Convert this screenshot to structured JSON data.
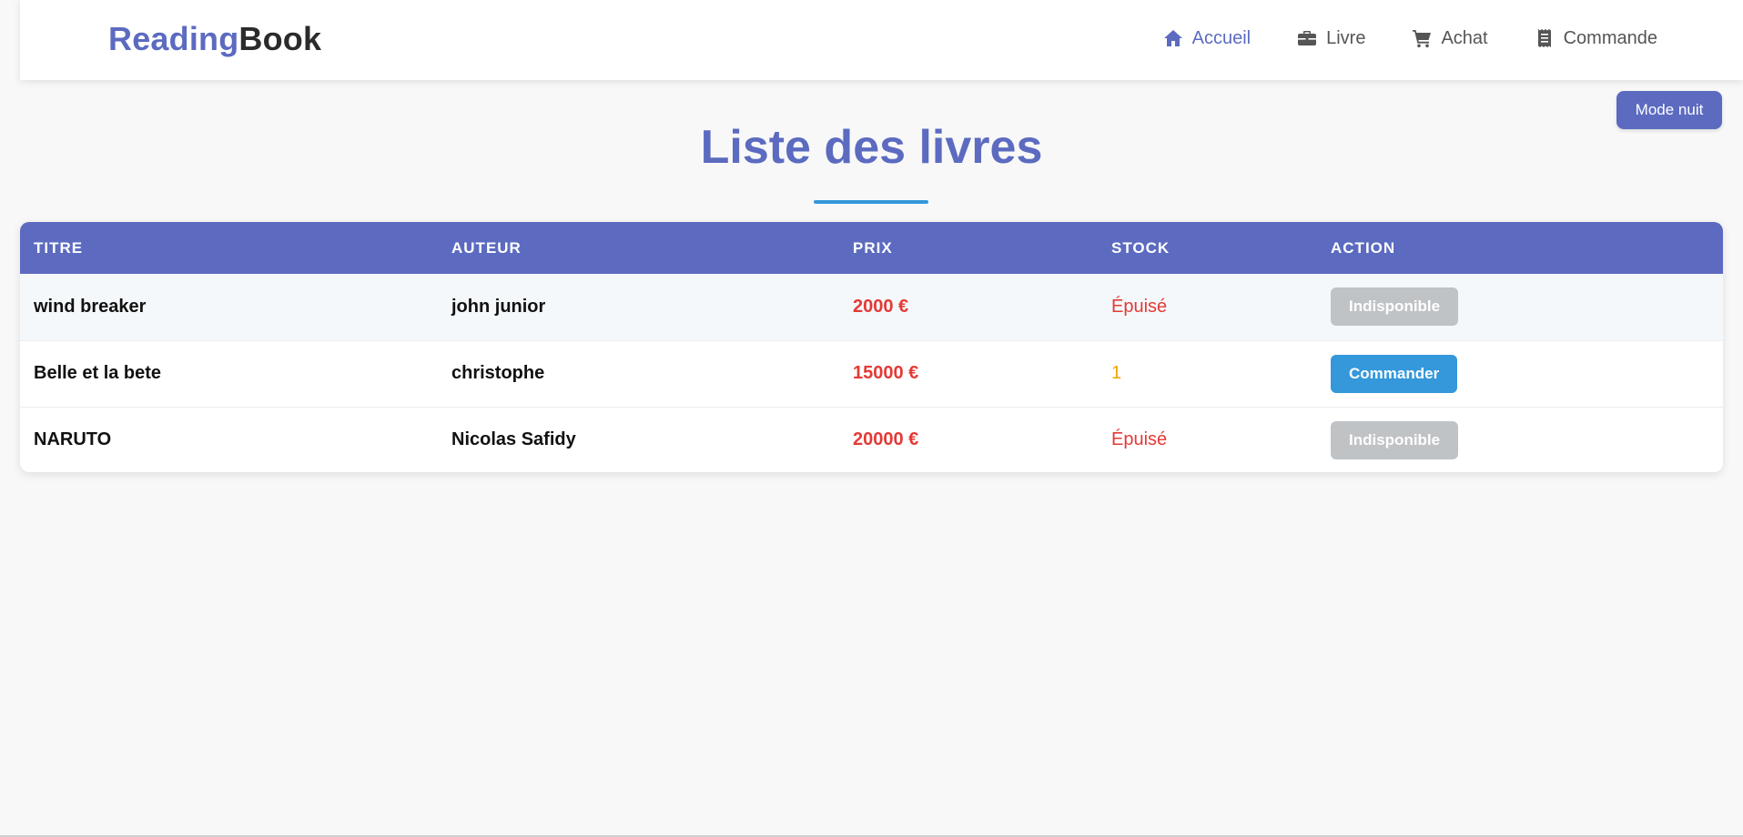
{
  "brand": {
    "part1": "Reading",
    "part2": "Book"
  },
  "nav": {
    "items": [
      {
        "label": "Accueil",
        "icon": "home-icon",
        "active": true
      },
      {
        "label": "Livre",
        "icon": "briefcase-icon",
        "active": false
      },
      {
        "label": "Achat",
        "icon": "cart-icon",
        "active": false
      },
      {
        "label": "Commande",
        "icon": "receipt-icon",
        "active": false
      }
    ]
  },
  "night_mode_label": "Mode nuit",
  "page_title": "Liste des livres",
  "table": {
    "headers": [
      "TITRE",
      "AUTEUR",
      "PRIX",
      "STOCK",
      "ACTION"
    ],
    "rows": [
      {
        "titre": "wind breaker",
        "auteur": "john junior",
        "prix": "2000 €",
        "stock": "Épuisé",
        "action": "Indisponible",
        "available": false
      },
      {
        "titre": "Belle et la bete",
        "auteur": "christophe",
        "prix": "15000 €",
        "stock": "1",
        "action": "Commander",
        "available": true
      },
      {
        "titre": "NARUTO",
        "auteur": "Nicolas Safidy",
        "prix": "20000 €",
        "stock": "Épuisé",
        "action": "Indisponible",
        "available": false
      }
    ]
  },
  "colors": {
    "accent": "#5c6bc0",
    "order_button": "#3498db",
    "disabled_button": "#c0c3c6",
    "price": "#e53935",
    "stock_low": "#f0a500"
  }
}
